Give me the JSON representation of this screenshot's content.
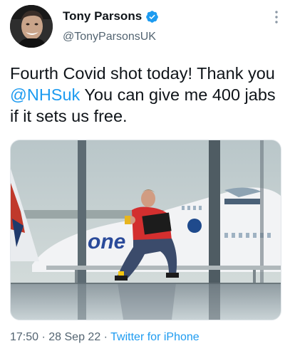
{
  "tweet": {
    "author_name": "Tony Parsons",
    "author_handle": "@TonyParsonsUK",
    "text_before": "Fourth Covid shot today! Thank you ",
    "mention": "@NHSuk",
    "text_after": " You can give me 400 jabs if it sets us free.",
    "time": "17:50",
    "separator_1": " · ",
    "date": "28 Sep 22",
    "separator_2": " · ",
    "source": "Twitter for iPhone"
  },
  "icons": {
    "verified": "verified-badge-icon",
    "more": "more-vertical-icon"
  },
  "colors": {
    "accent": "#1d9bf0",
    "text": "#0f1419",
    "secondary": "#536471"
  }
}
